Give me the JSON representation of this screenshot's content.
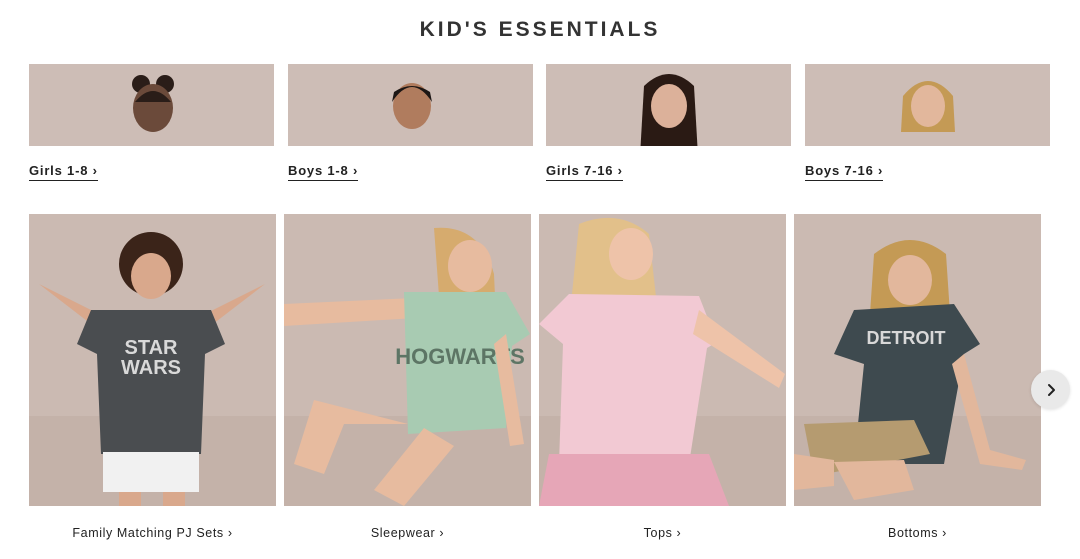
{
  "section": {
    "title": "KID'S ESSENTIALS"
  },
  "categories": [
    {
      "label": "Girls 1-8 ›"
    },
    {
      "label": "Boys 1-8 ›"
    },
    {
      "label": "Girls 7-16 ›"
    },
    {
      "label": "Boys 7-16 ›"
    }
  ],
  "products": [
    {
      "label": "Family Matching PJ Sets ›",
      "shirt_color": "#4a4d50",
      "shirt_text": "STAR WARS"
    },
    {
      "label": "Sleepwear ›",
      "shirt_color": "#a8cbb2",
      "shirt_text": "HOGWARTS"
    },
    {
      "label": "Tops ›",
      "shirt_color": "#f2c9d3",
      "shirt_text": ""
    },
    {
      "label": "Bottoms ›",
      "shirt_color": "#3e4a4f",
      "shirt_text": "DETROIT"
    }
  ],
  "carousel": {
    "next_icon": "chevron-right-icon"
  },
  "colors": {
    "image_background": "#cdbdb6",
    "title_text": "#333333"
  }
}
